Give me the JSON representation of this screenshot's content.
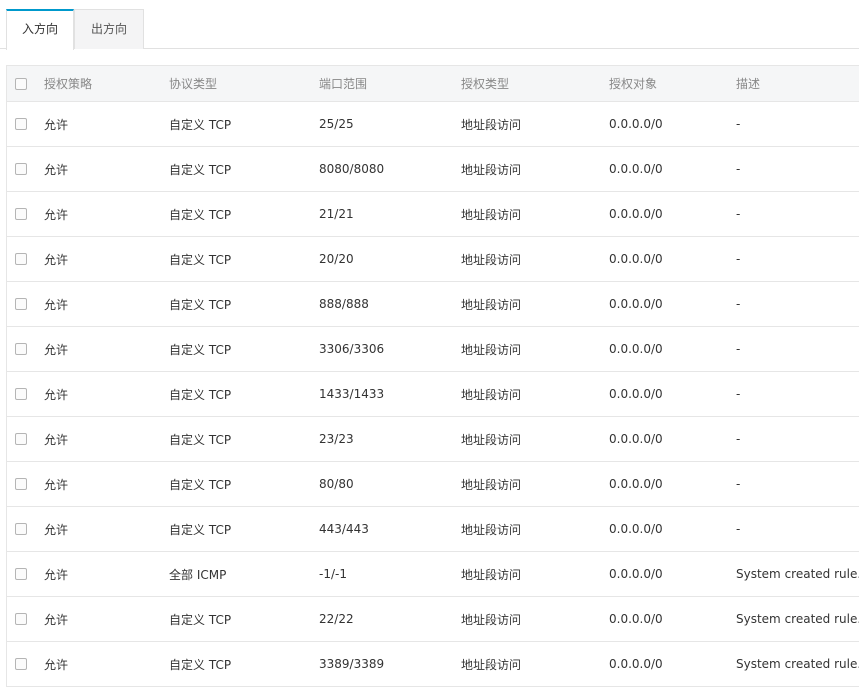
{
  "tabs": {
    "inbound": "入方向",
    "outbound": "出方向"
  },
  "table": {
    "columns": [
      "授权策略",
      "协议类型",
      "端口范围",
      "授权类型",
      "授权对象",
      "描述"
    ],
    "rows": [
      {
        "policy": "允许",
        "protocol": "自定义 TCP",
        "port": "25/25",
        "auth_type": "地址段访问",
        "target": "0.0.0.0/0",
        "desc": "-"
      },
      {
        "policy": "允许",
        "protocol": "自定义 TCP",
        "port": "8080/8080",
        "auth_type": "地址段访问",
        "target": "0.0.0.0/0",
        "desc": "-"
      },
      {
        "policy": "允许",
        "protocol": "自定义 TCP",
        "port": "21/21",
        "auth_type": "地址段访问",
        "target": "0.0.0.0/0",
        "desc": "-"
      },
      {
        "policy": "允许",
        "protocol": "自定义 TCP",
        "port": "20/20",
        "auth_type": "地址段访问",
        "target": "0.0.0.0/0",
        "desc": "-"
      },
      {
        "policy": "允许",
        "protocol": "自定义 TCP",
        "port": "888/888",
        "auth_type": "地址段访问",
        "target": "0.0.0.0/0",
        "desc": "-"
      },
      {
        "policy": "允许",
        "protocol": "自定义 TCP",
        "port": "3306/3306",
        "auth_type": "地址段访问",
        "target": "0.0.0.0/0",
        "desc": "-"
      },
      {
        "policy": "允许",
        "protocol": "自定义 TCP",
        "port": "1433/1433",
        "auth_type": "地址段访问",
        "target": "0.0.0.0/0",
        "desc": "-"
      },
      {
        "policy": "允许",
        "protocol": "自定义 TCP",
        "port": "23/23",
        "auth_type": "地址段访问",
        "target": "0.0.0.0/0",
        "desc": "-"
      },
      {
        "policy": "允许",
        "protocol": "自定义 TCP",
        "port": "80/80",
        "auth_type": "地址段访问",
        "target": "0.0.0.0/0",
        "desc": "-"
      },
      {
        "policy": "允许",
        "protocol": "自定义 TCP",
        "port": "443/443",
        "auth_type": "地址段访问",
        "target": "0.0.0.0/0",
        "desc": "-"
      },
      {
        "policy": "允许",
        "protocol": "全部 ICMP",
        "port": "-1/-1",
        "auth_type": "地址段访问",
        "target": "0.0.0.0/0",
        "desc": "System created rule."
      },
      {
        "policy": "允许",
        "protocol": "自定义 TCP",
        "port": "22/22",
        "auth_type": "地址段访问",
        "target": "0.0.0.0/0",
        "desc": "System created rule."
      },
      {
        "policy": "允许",
        "protocol": "自定义 TCP",
        "port": "3389/3389",
        "auth_type": "地址段访问",
        "target": "0.0.0.0/0",
        "desc": "System created rule."
      }
    ]
  }
}
